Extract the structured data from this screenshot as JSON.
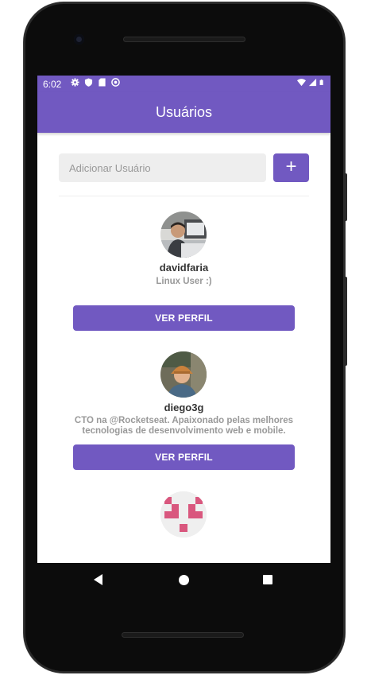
{
  "status_bar": {
    "time": "6:02",
    "left_icons": [
      "gear-icon",
      "shield-icon",
      "sd-card-icon",
      "accessibility-icon"
    ],
    "right_icons": [
      "wifi-icon",
      "signal-icon",
      "battery-icon"
    ]
  },
  "header": {
    "title": "Usuários",
    "background": "#7159c1"
  },
  "search": {
    "placeholder": "Adicionar Usuário",
    "value": "",
    "add_label": "+"
  },
  "users": [
    {
      "name": "davidfaria",
      "bio": "Linux User :)",
      "button_label": "VER PERFIL",
      "avatar": "photo-avatar"
    },
    {
      "name": "diego3g",
      "bio": "CTO na @Rocketseat. Apaixonado pelas melhores tecnologias de desenvolvimento web e mobile.",
      "button_label": "VER PERFIL",
      "avatar": "photo-avatar"
    },
    {
      "name": "",
      "bio": "",
      "button_label": "",
      "avatar": "identicon-avatar"
    }
  ],
  "nav": {
    "icons": [
      "back-icon",
      "home-icon",
      "recents-icon"
    ]
  },
  "colors": {
    "accent": "#7159c1",
    "identicon": "#d9577e"
  }
}
